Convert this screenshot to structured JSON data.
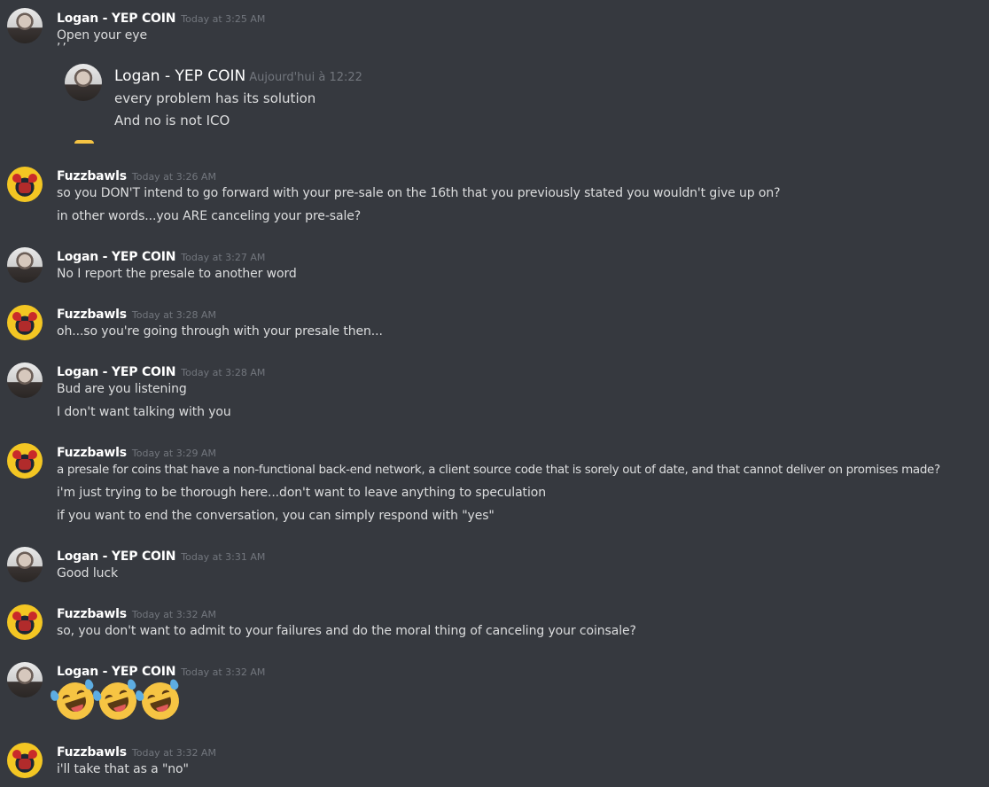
{
  "colors": {
    "background": "#36393f",
    "username": "#ffffff",
    "timestamp": "#72767d",
    "text": "#dcddde"
  },
  "quoted": {
    "name": "Logan - YEP COIN",
    "timestamp": "Aujourd'hui à 12:22",
    "lines": [
      "every problem has its solution",
      "And no is not ICO"
    ]
  },
  "messages": [
    {
      "author": "Logan - YEP COIN",
      "avatar": "logan-avatar-icon",
      "timestamp": "Today at 3:25 AM",
      "lines": [
        "Open your eye"
      ]
    },
    {
      "author": "Fuzzbawls",
      "avatar": "fuzzbawls-avatar-icon",
      "timestamp": "Today at 3:26 AM",
      "lines": [
        "so you DON'T intend to go forward with your pre-sale on the 16th that you previously stated you wouldn't give up on?",
        "in other words...you ARE canceling your pre-sale?"
      ]
    },
    {
      "author": "Logan - YEP COIN",
      "avatar": "logan-avatar-icon",
      "timestamp": "Today at 3:27 AM",
      "lines": [
        "No I report the presale to another word"
      ]
    },
    {
      "author": "Fuzzbawls",
      "avatar": "fuzzbawls-avatar-icon",
      "timestamp": "Today at 3:28 AM",
      "lines": [
        "oh...so you're going through with your presale then..."
      ]
    },
    {
      "author": "Logan - YEP COIN",
      "avatar": "logan-avatar-icon",
      "timestamp": "Today at 3:28 AM",
      "lines": [
        "Bud are you listening",
        "I don't want talking with you"
      ]
    },
    {
      "author": "Fuzzbawls",
      "avatar": "fuzzbawls-avatar-icon",
      "timestamp": "Today at 3:29 AM",
      "lines": [
        "a presale for coins that have a non-functional back-end network, a client source code that is sorely out of date, and that cannot deliver on promises made?",
        "i'm just trying to be thorough here...don't want to leave anything to speculation",
        "if you want to end the conversation, you can simply respond with \"yes\""
      ]
    },
    {
      "author": "Logan - YEP COIN",
      "avatar": "logan-avatar-icon",
      "timestamp": "Today at 3:31 AM",
      "lines": [
        "Good luck"
      ]
    },
    {
      "author": "Fuzzbawls",
      "avatar": "fuzzbawls-avatar-icon",
      "timestamp": "Today at 3:32 AM",
      "lines": [
        "so, you don't want to admit to your failures and do the moral thing of canceling your coinsale?"
      ]
    },
    {
      "author": "Logan - YEP COIN",
      "avatar": "logan-avatar-icon",
      "timestamp": "Today at 3:32 AM",
      "emoji": [
        "rolling-on-floor-laughing-icon",
        "rolling-on-floor-laughing-icon",
        "rolling-on-floor-laughing-icon"
      ]
    },
    {
      "author": "Fuzzbawls",
      "avatar": "fuzzbawls-avatar-icon",
      "timestamp": "Today at 3:32 AM",
      "lines": [
        "i'll take that as a \"no\""
      ]
    }
  ]
}
